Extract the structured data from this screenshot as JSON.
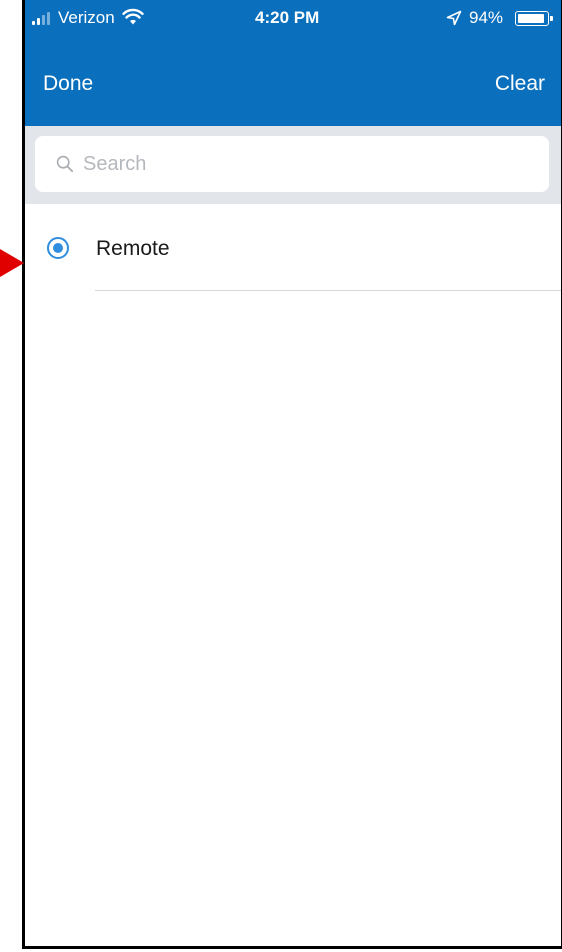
{
  "status_bar": {
    "carrier": "Verizon",
    "time": "4:20 PM",
    "battery_percent": "94%",
    "battery_level": 0.94,
    "icons": [
      "signal-icon",
      "wifi-icon",
      "location-arrow-icon",
      "battery-icon"
    ]
  },
  "nav": {
    "done_label": "Done",
    "clear_label": "Clear"
  },
  "search": {
    "placeholder": "Search",
    "value": "",
    "icon": "search-icon"
  },
  "options": [
    {
      "label": "Remote",
      "selected": true
    }
  ],
  "colors": {
    "header_bg": "#0a6fbd",
    "header_text": "#ffffff",
    "search_area_bg": "#e2e6ea",
    "radio_accent": "#2f8ee0",
    "annotation": "#e00000"
  }
}
